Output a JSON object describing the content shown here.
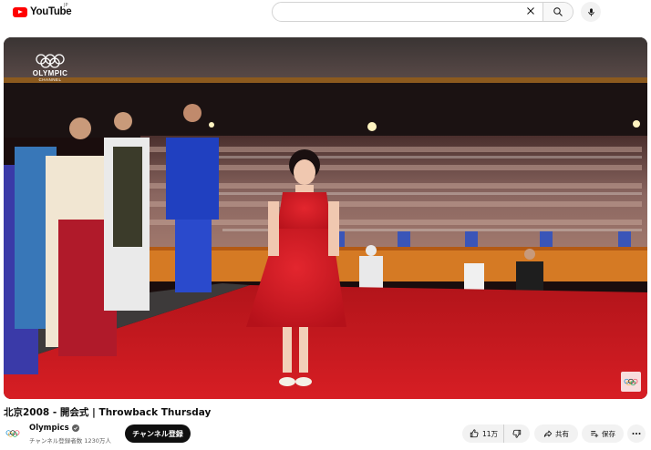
{
  "header": {
    "logo_text": "YouTube",
    "country_code": "JP",
    "search_placeholder": "",
    "icons": [
      "youtube-logo",
      "clear-icon",
      "search-icon",
      "mic-icon"
    ]
  },
  "player": {
    "channel_logo_line1": "OLYMPIC",
    "channel_logo_line2": "CHANNEL",
    "watermark": "olympic-rings"
  },
  "video": {
    "title": "北京2008 - 開会式 | Throwback Thursday"
  },
  "channel": {
    "name": "Olympics",
    "subscribers": "チャンネル登録者数 1230万人",
    "subscribe_label": "チャンネル登録"
  },
  "actions": {
    "likes": "11万",
    "share_label": "共有",
    "save_label": "保存"
  },
  "colors": {
    "brand_red": "#ff0000",
    "text_primary": "#0f0f0f",
    "text_secondary": "#606060",
    "button_bg": "#f2f2f2",
    "subscribe_bg": "#0f0f0f"
  }
}
